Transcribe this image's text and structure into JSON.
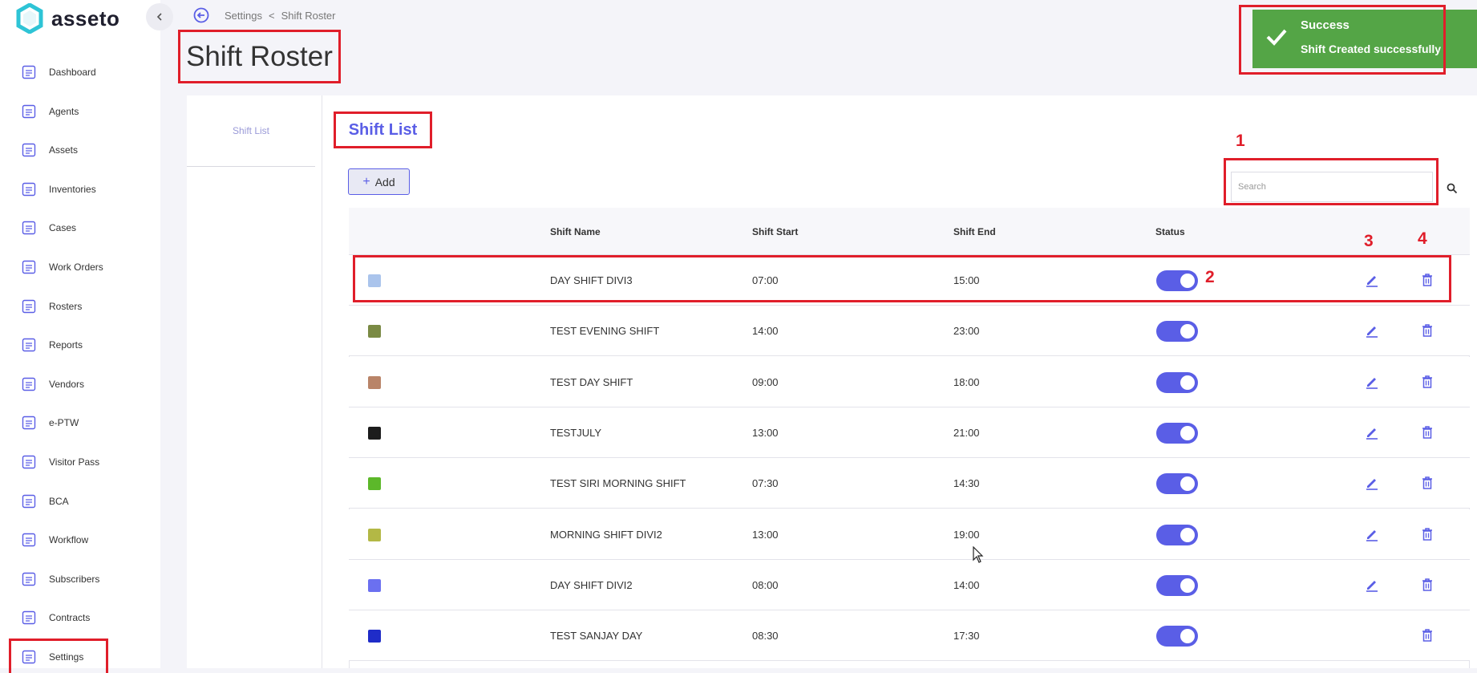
{
  "app": {
    "name": "asseto",
    "accent": "#5a5ee6"
  },
  "sidebar": {
    "items": [
      {
        "label": "Dashboard",
        "icon": "dashboard-icon"
      },
      {
        "label": "Agents",
        "icon": "agents-icon"
      },
      {
        "label": "Assets",
        "icon": "assets-icon"
      },
      {
        "label": "Inventories",
        "icon": "inventories-icon"
      },
      {
        "label": "Cases",
        "icon": "cases-icon"
      },
      {
        "label": "Work Orders",
        "icon": "work-orders-icon"
      },
      {
        "label": "Rosters",
        "icon": "rosters-icon"
      },
      {
        "label": "Reports",
        "icon": "reports-icon"
      },
      {
        "label": "Vendors",
        "icon": "vendors-icon"
      },
      {
        "label": "e-PTW",
        "icon": "eptw-icon"
      },
      {
        "label": "Visitor Pass",
        "icon": "visitor-pass-icon"
      },
      {
        "label": "BCA",
        "icon": "bca-icon"
      },
      {
        "label": "Workflow",
        "icon": "workflow-icon"
      },
      {
        "label": "Subscribers",
        "icon": "subscribers-icon"
      },
      {
        "label": "Contracts",
        "icon": "contracts-icon"
      },
      {
        "label": "Settings",
        "icon": "settings-icon",
        "active": true
      }
    ]
  },
  "breadcrumb": {
    "parent": "Settings",
    "separator": "<",
    "current": "Shift Roster"
  },
  "page": {
    "title": "Shift Roster"
  },
  "toast": {
    "title": "Success",
    "message": "Shift Created successfully",
    "color": "#54a546"
  },
  "side_tabs": [
    {
      "label": "Shift List"
    }
  ],
  "section": {
    "title": "Shift List"
  },
  "toolbar": {
    "add_label": "Add",
    "add_symbol": "+"
  },
  "search": {
    "placeholder": "Search",
    "value": ""
  },
  "annotations": {
    "search": "1",
    "status": "2",
    "edit": "3",
    "delete": "4"
  },
  "table": {
    "headers": {
      "name": "Shift Name",
      "start": "Shift Start",
      "end": "Shift End",
      "status": "Status"
    },
    "rows": [
      {
        "color": "#aac4ec",
        "name": "DAY SHIFT DIVI3",
        "start": "07:00",
        "end": "15:00",
        "status": true,
        "editable": true
      },
      {
        "color": "#7a8a44",
        "name": "TEST EVENING SHIFT",
        "start": "14:00",
        "end": "23:00",
        "status": true,
        "editable": true
      },
      {
        "color": "#b98468",
        "name": "TEST DAY SHIFT",
        "start": "09:00",
        "end": "18:00",
        "status": true,
        "editable": true
      },
      {
        "color": "#1c1c1c",
        "name": "TESTJULY",
        "start": "13:00",
        "end": "21:00",
        "status": true,
        "editable": true
      },
      {
        "color": "#5cb82a",
        "name": "TEST SIRI MORNING SHIFT",
        "start": "07:30",
        "end": "14:30",
        "status": true,
        "editable": true
      },
      {
        "color": "#b3b845",
        "name": "MORNING SHIFT DIVI2",
        "start": "13:00",
        "end": "19:00",
        "status": true,
        "editable": true
      },
      {
        "color": "#6b70f0",
        "name": "DAY SHIFT DIVI2",
        "start": "08:00",
        "end": "14:00",
        "status": true,
        "editable": true
      },
      {
        "color": "#1f2cc8",
        "name": "TEST SANJAY DAY",
        "start": "08:30",
        "end": "17:30",
        "status": true,
        "editable": false
      }
    ]
  }
}
